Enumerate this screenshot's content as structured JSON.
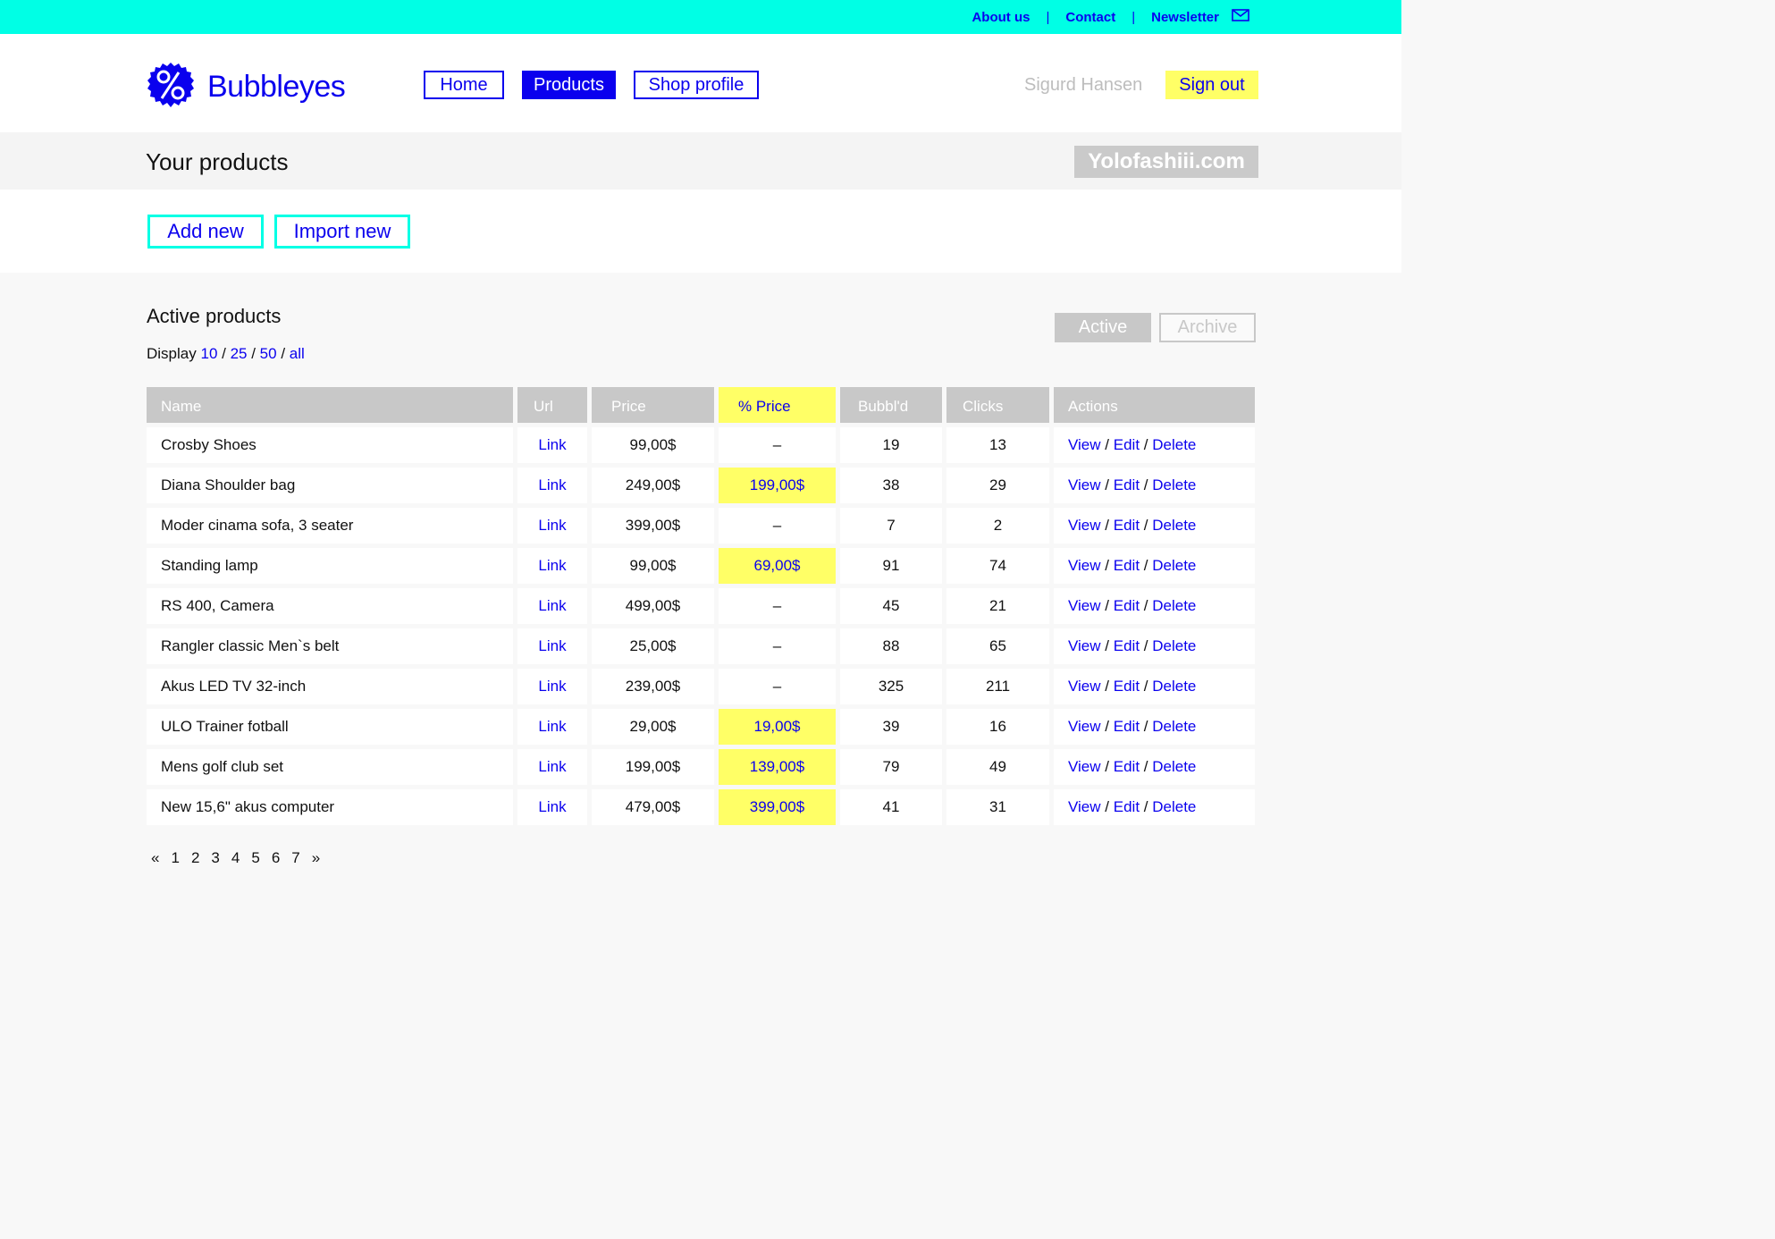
{
  "topbar": {
    "about": "About us",
    "contact": "Contact",
    "newsletter": "Newsletter",
    "mail_icon": "envelope-icon"
  },
  "brand": {
    "name": "Bubbleyes",
    "logo_icon": "percent-badge-icon",
    "color": "#0a00ee",
    "accent": "#00ffe5",
    "highlight": "#ffff66"
  },
  "nav": {
    "home": "Home",
    "products": "Products",
    "shop_profile": "Shop profile"
  },
  "user": {
    "name": "Sigurd Hansen",
    "signout": "Sign out"
  },
  "page": {
    "title": "Your products",
    "shop": "Yolofashiii.com"
  },
  "actions": {
    "add": "Add new",
    "import": "Import new"
  },
  "section": {
    "title": "Active products",
    "display_label": "Display",
    "display_options": [
      "10",
      "25",
      "50",
      "all"
    ],
    "toggle_active": "Active",
    "toggle_archive": "Archive"
  },
  "table": {
    "headers": [
      "Name",
      "Url",
      "Price",
      "% Price",
      "Bubbl'd",
      "Clicks",
      "Actions"
    ],
    "link_label": "Link",
    "actions": {
      "view": "View",
      "edit": "Edit",
      "delete": "Delete",
      "sep": "/"
    },
    "rows": [
      {
        "name": "Crosby Shoes",
        "price": "99,00$",
        "sale": "–",
        "bubbled": "19",
        "clicks": "13"
      },
      {
        "name": "Diana Shoulder bag",
        "price": "249,00$",
        "sale": "199,00$",
        "bubbled": "38",
        "clicks": "29"
      },
      {
        "name": "Moder cinama sofa, 3 seater",
        "price": "399,00$",
        "sale": "–",
        "bubbled": "7",
        "clicks": "2"
      },
      {
        "name": "Standing lamp",
        "price": "99,00$",
        "sale": "69,00$",
        "bubbled": "91",
        "clicks": "74"
      },
      {
        "name": "RS 400, Camera",
        "price": "499,00$",
        "sale": "–",
        "bubbled": "45",
        "clicks": "21"
      },
      {
        "name": "Rangler classic Men`s belt",
        "price": "25,00$",
        "sale": "–",
        "bubbled": "88",
        "clicks": "65"
      },
      {
        "name": "Akus LED TV 32-inch",
        "price": "239,00$",
        "sale": "–",
        "bubbled": "325",
        "clicks": "211"
      },
      {
        "name": "ULO Trainer fotball",
        "price": "29,00$",
        "sale": "19,00$",
        "bubbled": "39",
        "clicks": "16"
      },
      {
        "name": "Mens golf club set",
        "price": "199,00$",
        "sale": "139,00$",
        "bubbled": "79",
        "clicks": "49"
      },
      {
        "name": "New 15,6\" akus computer",
        "price": "479,00$",
        "sale": "399,00$",
        "bubbled": "41",
        "clicks": "31"
      }
    ]
  },
  "pagination": {
    "prev": "«",
    "pages": [
      "1",
      "2",
      "3",
      "4",
      "5",
      "6",
      "7"
    ],
    "next": "»"
  }
}
